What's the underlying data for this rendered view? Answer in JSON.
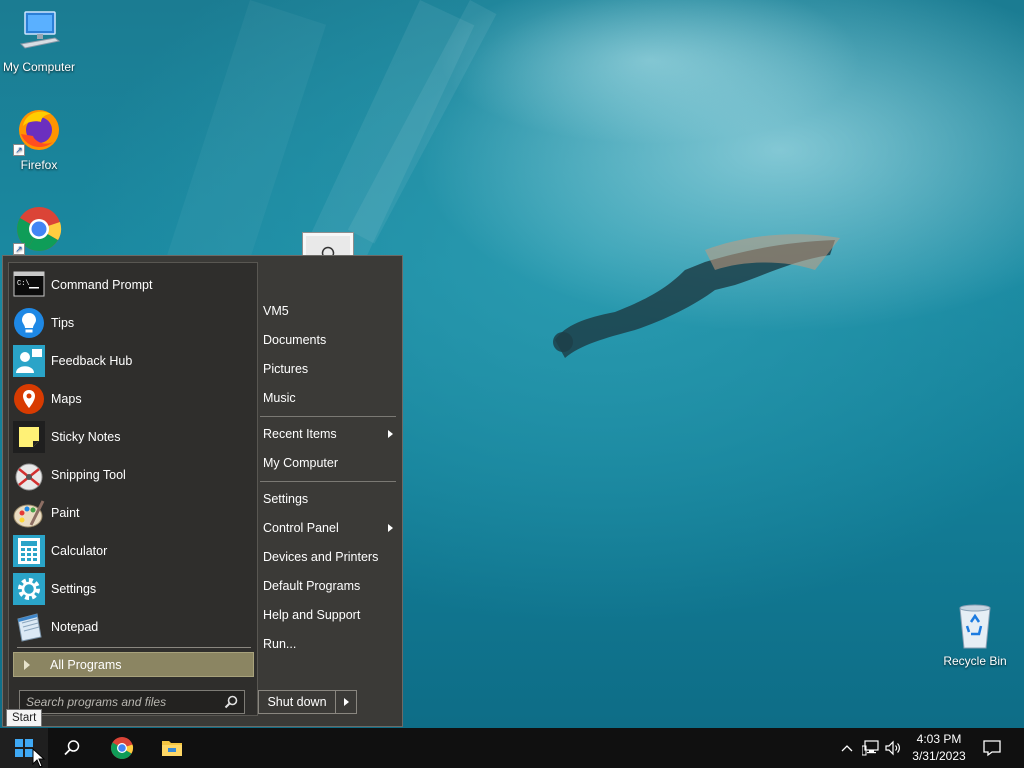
{
  "desktop": {
    "icons": [
      {
        "label": "My Computer"
      },
      {
        "label": "Firefox"
      },
      {
        "label": ""
      },
      {
        "label": "Recycle Bin"
      }
    ]
  },
  "start_menu": {
    "programs": [
      {
        "label": "Command Prompt",
        "icon": "command-prompt-icon"
      },
      {
        "label": "Tips",
        "icon": "tips-icon"
      },
      {
        "label": "Feedback Hub",
        "icon": "feedback-hub-icon"
      },
      {
        "label": "Maps",
        "icon": "maps-icon"
      },
      {
        "label": "Sticky Notes",
        "icon": "sticky-notes-icon"
      },
      {
        "label": "Snipping Tool",
        "icon": "snipping-tool-icon"
      },
      {
        "label": "Paint",
        "icon": "paint-icon"
      },
      {
        "label": "Calculator",
        "icon": "calculator-icon"
      },
      {
        "label": "Settings",
        "icon": "settings-icon"
      },
      {
        "label": "Notepad",
        "icon": "notepad-icon"
      }
    ],
    "all_programs": "All Programs",
    "search_placeholder": "Search programs and files",
    "right_items": [
      {
        "label": "VM5"
      },
      {
        "label": "Documents"
      },
      {
        "label": "Pictures"
      },
      {
        "label": "Music"
      },
      {
        "label": "Recent Items",
        "submenu": true
      },
      {
        "label": "My Computer"
      },
      {
        "label": "Settings"
      },
      {
        "label": "Control Panel",
        "submenu": true
      },
      {
        "label": "Devices and Printers"
      },
      {
        "label": "Default Programs"
      },
      {
        "label": "Help and Support"
      },
      {
        "label": "Run..."
      }
    ],
    "shutdown_label": "Shut down",
    "start_tooltip": "Start"
  },
  "taskbar": {
    "clock_time": "4:03 PM",
    "clock_date": "3/31/2023"
  },
  "colors": {
    "menu_bg": "#3b3a37",
    "all_programs_highlight": "#8b8562",
    "taskbar_bg": "#101010"
  }
}
